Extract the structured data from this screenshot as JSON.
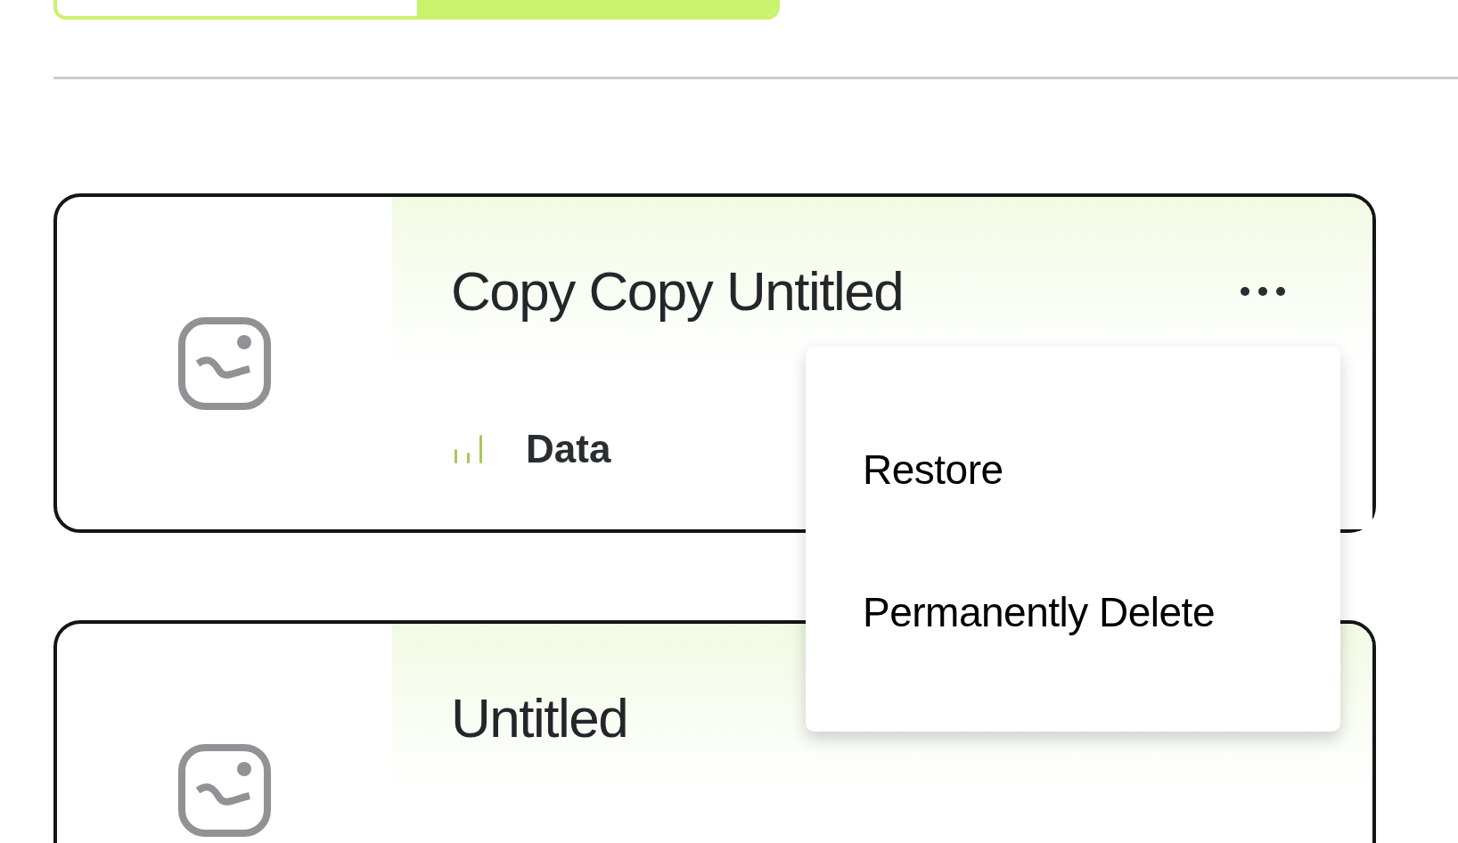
{
  "view_toggle": {
    "options": [
      {
        "selected": false
      },
      {
        "selected": true
      }
    ]
  },
  "cards": [
    {
      "title": "Copy Copy Untitled",
      "type_label": "Data",
      "menu_open": true,
      "menu": [
        {
          "label": "Restore"
        },
        {
          "label": "Permanently Delete"
        }
      ]
    },
    {
      "title": "Untitled"
    }
  ]
}
